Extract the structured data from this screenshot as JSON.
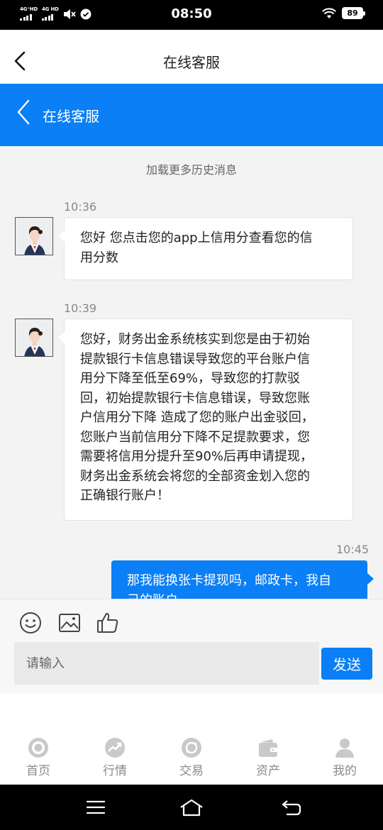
{
  "status_bar": {
    "net1": "4G⁺HD",
    "net2": "4G HD",
    "time": "08:50",
    "battery": "89"
  },
  "top_nav": {
    "title": "在线客服"
  },
  "chat_header": {
    "title": "在线客服"
  },
  "chat": {
    "load_more": "加载更多历史消息",
    "messages": [
      {
        "side": "left",
        "time": "10:36",
        "lines": [
          "您好 您点击您的app上信用分查看您的信",
          "用分数"
        ]
      },
      {
        "side": "left",
        "time": "10:39",
        "lines": [
          "您好，财务出金系统核实到您是由于初始",
          "提款银行卡信息错误导致您的平台账户信",
          "用分下降至低至69%，导致您的打款驳",
          "回，初始提款银行卡信息错误，导致您账",
          "户信用分下降 造成了您的账户出金驳回，",
          "您账户当前信用分下降不足提款要求，您",
          "需要将信用分提升至90%后再申请提现，",
          "财务出金系统会将您的全部资金划入您的",
          "正确银行账户！"
        ]
      },
      {
        "side": "right",
        "time": "10:45",
        "lines": [
          "那我能换张卡提现吗，邮政卡，我自",
          "己的账户"
        ]
      }
    ]
  },
  "composer": {
    "placeholder": "请输入",
    "send_label": "发送",
    "tools": [
      "emoji-icon",
      "image-icon",
      "thumbs-up-icon"
    ]
  },
  "tabs": [
    {
      "label": "首页",
      "icon": "home-target-icon"
    },
    {
      "label": "行情",
      "icon": "market-trend-icon"
    },
    {
      "label": "交易",
      "icon": "trade-exchange-icon"
    },
    {
      "label": "资产",
      "icon": "wallet-icon"
    },
    {
      "label": "我的",
      "icon": "user-icon"
    }
  ],
  "colors": {
    "accent": "#0b7ff5",
    "chat_bg": "#f3f3f3",
    "tab_inactive": "#8a8a8a"
  }
}
